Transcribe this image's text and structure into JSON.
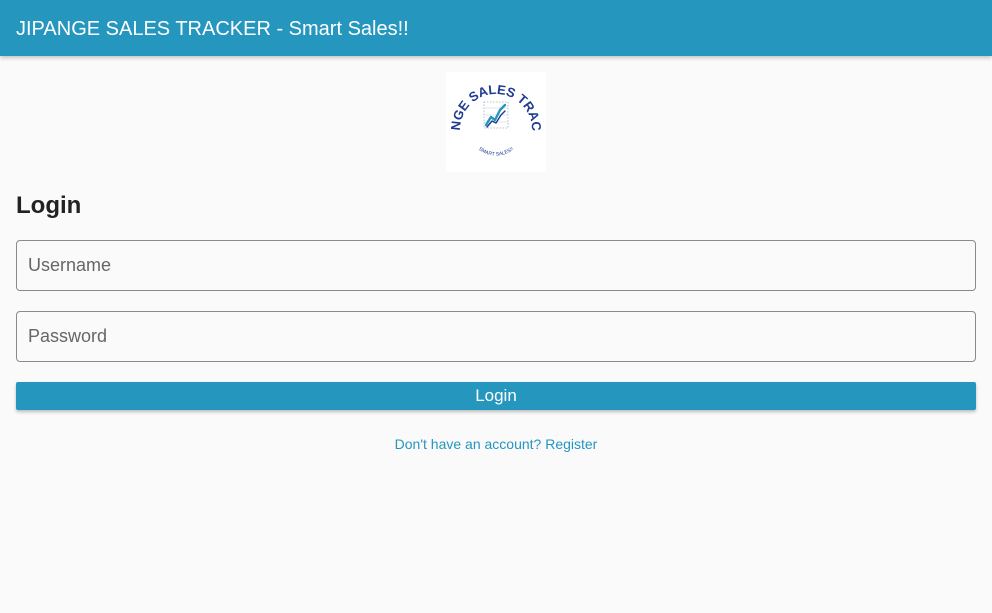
{
  "app_bar": {
    "title": "JIPANGE SALES TRACKER - Smart Sales!!"
  },
  "logo": {
    "ring_text_top": "JIPANGE SALES TRACKER",
    "ring_text_bottom": "SMART SALES!!",
    "ring_color": "#1f3a93",
    "accent_color": "#2596be",
    "icon": "trend-chart-icon"
  },
  "login_form": {
    "heading": "Login",
    "username_placeholder": "Username",
    "password_placeholder": "Password",
    "username_value": "",
    "password_value": "",
    "submit_label": "Login",
    "register_link": "Don't have an account? Register"
  },
  "colors": {
    "primary": "#2596be",
    "background": "#fafafa",
    "field_border": "#8a8a8a"
  }
}
